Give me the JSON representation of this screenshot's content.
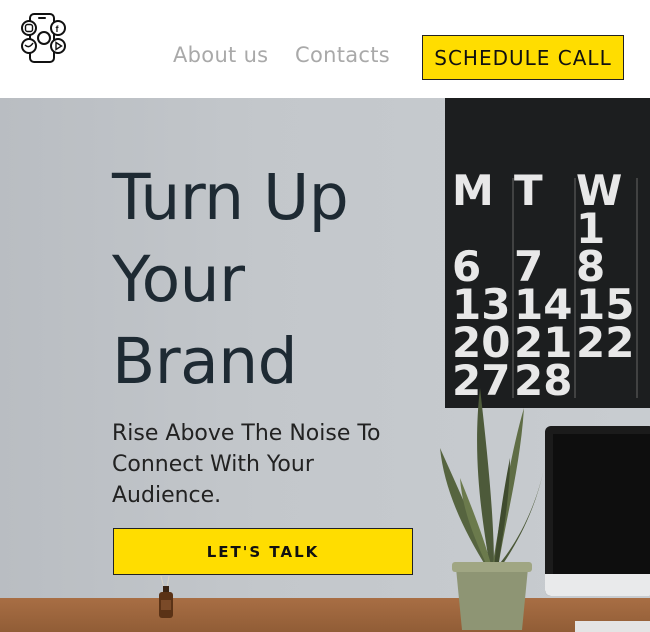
{
  "header": {
    "logo_icon": "social-phone-logo-icon",
    "nav": {
      "about_label": "About us",
      "contacts_label": "Contacts"
    },
    "cta_label": "SCHEDULE CALL"
  },
  "hero": {
    "title_lines": [
      "Turn Up",
      "Your",
      "Brand"
    ],
    "subtitle": "Rise Above The Noise To Connect With Your Audience.",
    "cta_label": "LET'S TALK",
    "calendar": {
      "days": [
        "M",
        "T",
        "W"
      ],
      "rows": [
        [
          "",
          "",
          "1"
        ],
        [
          "6",
          "7",
          "8"
        ],
        [
          "13",
          "14",
          "15"
        ],
        [
          "20",
          "21",
          "22"
        ],
        [
          "27",
          "28",
          ""
        ]
      ]
    }
  },
  "colors": {
    "accent": "#ffdd00",
    "title_text": "#1e2a33",
    "nav_text": "#a9a9a9"
  }
}
